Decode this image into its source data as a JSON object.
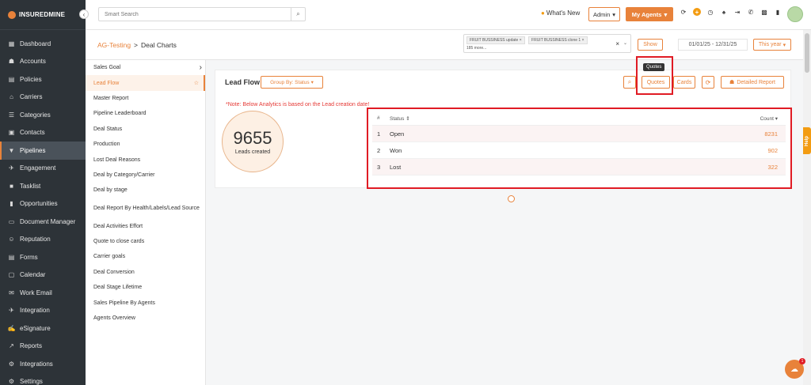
{
  "brand": {
    "logo_text": "INSUREDMINE"
  },
  "sidebar": {
    "items": [
      {
        "label": "Dashboard",
        "icon": "▦"
      },
      {
        "label": "Accounts",
        "icon": "☗"
      },
      {
        "label": "Policies",
        "icon": "▤"
      },
      {
        "label": "Carriers",
        "icon": "⌂"
      },
      {
        "label": "Categories",
        "icon": "☰"
      },
      {
        "label": "Contacts",
        "icon": "▣"
      },
      {
        "label": "Pipelines",
        "icon": "▼"
      },
      {
        "label": "Engagement",
        "icon": "✈"
      },
      {
        "label": "Tasklist",
        "icon": "■"
      },
      {
        "label": "Opportunities",
        "icon": "▮"
      },
      {
        "label": "Document Manager",
        "icon": "▭"
      },
      {
        "label": "Reputation",
        "icon": "☺"
      },
      {
        "label": "Forms",
        "icon": "▤"
      },
      {
        "label": "Calendar",
        "icon": "▢"
      },
      {
        "label": "Work Email",
        "icon": "✉"
      },
      {
        "label": "Integration",
        "icon": "✈"
      },
      {
        "label": "eSignature",
        "icon": "✍"
      },
      {
        "label": "Reports",
        "icon": "↗"
      },
      {
        "label": "Integrations",
        "icon": "⚙"
      },
      {
        "label": "Settings",
        "icon": "⚙"
      }
    ],
    "active_index": 6
  },
  "topbar": {
    "search_placeholder": "Smart Search",
    "whats_new": "What's New",
    "admin_label": "Admin",
    "agents_label": "My Agents"
  },
  "subbar": {
    "crumb_parent": "AG-Testing",
    "crumb_sep": ">",
    "crumb_current": "Deal Charts",
    "tags": [
      "FRUIT BUSSINESS update",
      "FRUIT BUSSINESS clone 1"
    ],
    "tags_more": "185 more...",
    "show_label": "Show",
    "date_range": "01/01/25 - 12/31/25",
    "year_label": "This year"
  },
  "reports": {
    "items": [
      "Sales Goal",
      "Lead Flow",
      "Master Report",
      "Pipeline Leaderboard",
      "Deal Status",
      "Production",
      "Lost Deal Reasons",
      "Deal by Category/Carrier",
      "Deal by stage",
      "Deal Report By Health/Labels/Lead Source",
      "Deal Activities Effort",
      "Quote to close cards",
      "Carrier goals",
      "Deal Conversion",
      "Deal Stage Lifetime",
      "Sales Pipeline By Agents",
      "Agents Overview"
    ],
    "active_index": 1
  },
  "panel": {
    "title": "Lead Flow",
    "group_by": "Group By: Status",
    "tooltip": "Quotes",
    "quotes_label": "Quotes",
    "cards_label": "Cards",
    "detailed_label": "Detailed Report",
    "note": "*Note: Below Analytics is based on the Lead creation date!",
    "total_value": "9655",
    "total_label": "Leads created"
  },
  "table": {
    "headers": {
      "num": "#",
      "status": "Status ⇕",
      "count": "Count ▾"
    },
    "rows": [
      {
        "num": "1",
        "status": "Open",
        "count": "8231"
      },
      {
        "num": "2",
        "status": "Won",
        "count": "902"
      },
      {
        "num": "3",
        "status": "Lost",
        "count": "322"
      }
    ]
  },
  "help": {
    "label": "Help"
  },
  "chat": {
    "badge": "1"
  },
  "colors": {
    "accent": "#e8823a",
    "sidebar_bg": "#2d3338",
    "highlight": "#e01b24"
  }
}
